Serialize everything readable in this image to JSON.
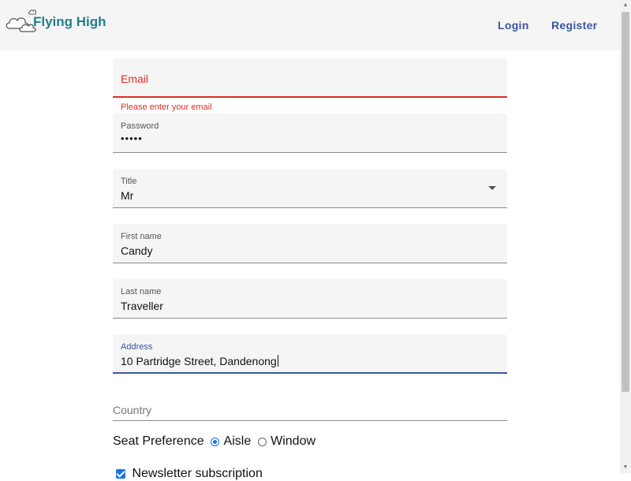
{
  "header": {
    "logo_text": "Flying High",
    "nav": {
      "login": "Login",
      "register": "Register"
    }
  },
  "form": {
    "email": {
      "label": "Email",
      "value": "",
      "error": "Please enter your email"
    },
    "password": {
      "label": "Password",
      "value": "•••••"
    },
    "title": {
      "label": "Title",
      "value": "Mr"
    },
    "first_name": {
      "label": "First name",
      "value": "Candy"
    },
    "last_name": {
      "label": "Last name",
      "value": "Traveller"
    },
    "address": {
      "label": "Address",
      "value": "10 Partridge Street, Dandenong"
    },
    "country": {
      "label": "Country",
      "value": ""
    },
    "seat": {
      "label": "Seat Preference",
      "options": [
        "Aisle",
        "Window"
      ],
      "selected": "Aisle"
    },
    "newsletter": {
      "label": "Newsletter subscription",
      "checked": true
    }
  },
  "colors": {
    "brand": "#1f7f8c",
    "nav": "#3a56a0",
    "error": "#d93025",
    "focus": "#3a56a0",
    "accent": "#1a73e8"
  },
  "icons": [
    "cloud-logo-icon",
    "select-arrow-icon"
  ]
}
